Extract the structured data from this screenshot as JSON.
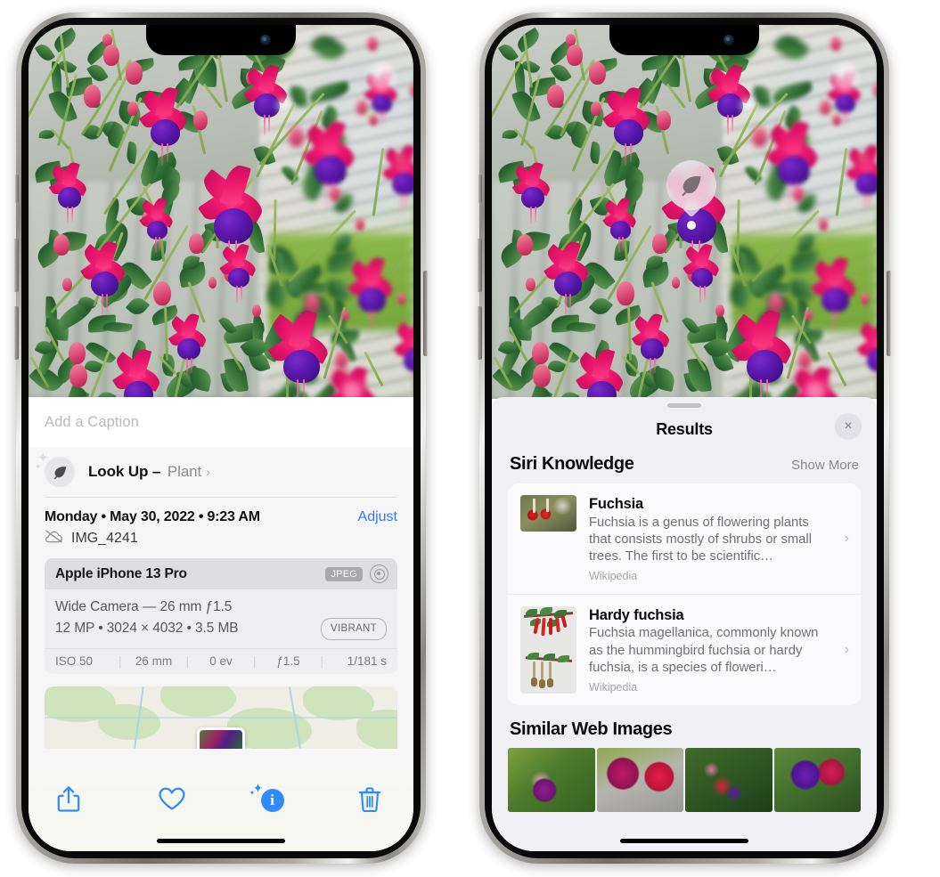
{
  "left_phone": {
    "caption": {
      "placeholder": "Add a Caption",
      "value": ""
    },
    "lookup": {
      "label": "Look Up",
      "dash": "–",
      "kind": "Plant",
      "chevron": "›",
      "icon": "leaf-icon"
    },
    "date_row": {
      "datetime": "Monday • May 30, 2022 • 9:23 AM",
      "adjust_label": "Adjust"
    },
    "file_row": {
      "icon": "cloud-slash-icon",
      "filename": "IMG_4241"
    },
    "camera_card": {
      "device": "Apple iPhone 13 Pro",
      "format_badge": "JPEG",
      "raw_icon": "raw-circles-icon",
      "lens_line": "Wide Camera — 26 mm ƒ1.5",
      "specs_line": "12 MP • 3024 × 4032 • 3.5 MB",
      "style_badge": "VIBRANT",
      "exif": [
        "ISO 50",
        "26 mm",
        "0 ev",
        "ƒ1.5",
        "1/181 s"
      ],
      "exif_separator": "|"
    },
    "toolbar": {
      "share_label": "share-icon",
      "favorite_label": "heart-icon",
      "info_label": "info-sparkle-icon",
      "delete_label": "trash-icon",
      "accent": "#2f8bfd"
    }
  },
  "right_phone": {
    "marker": {
      "icon": "leaf-icon"
    },
    "sheet": {
      "title": "Results",
      "close_label": "×",
      "sections": [
        {
          "title": "Siri Knowledge",
          "action": "Show More"
        },
        {
          "title": "Similar Web Images",
          "action": ""
        }
      ],
      "knowledge_items": [
        {
          "title": "Fuchsia",
          "description": "Fuchsia is a genus of flowering plants that consists mostly of shrubs or small trees. The first to be scientific…",
          "source": "Wikipedia",
          "chevron": "›"
        },
        {
          "title": "Hardy fuchsia",
          "description": "Fuchsia magellanica, commonly known as the hummingbird fuchsia or hardy fuchsia, is a species of floweri…",
          "source": "Wikipedia",
          "chevron": "›"
        }
      ],
      "similar_images_count": 4
    }
  },
  "colors": {
    "accent_blue": "#2f8bfd",
    "sheet_bg": "#f1f0f5",
    "info_bg": "#f6f6f7",
    "card_bg": "#fbfbfd"
  }
}
